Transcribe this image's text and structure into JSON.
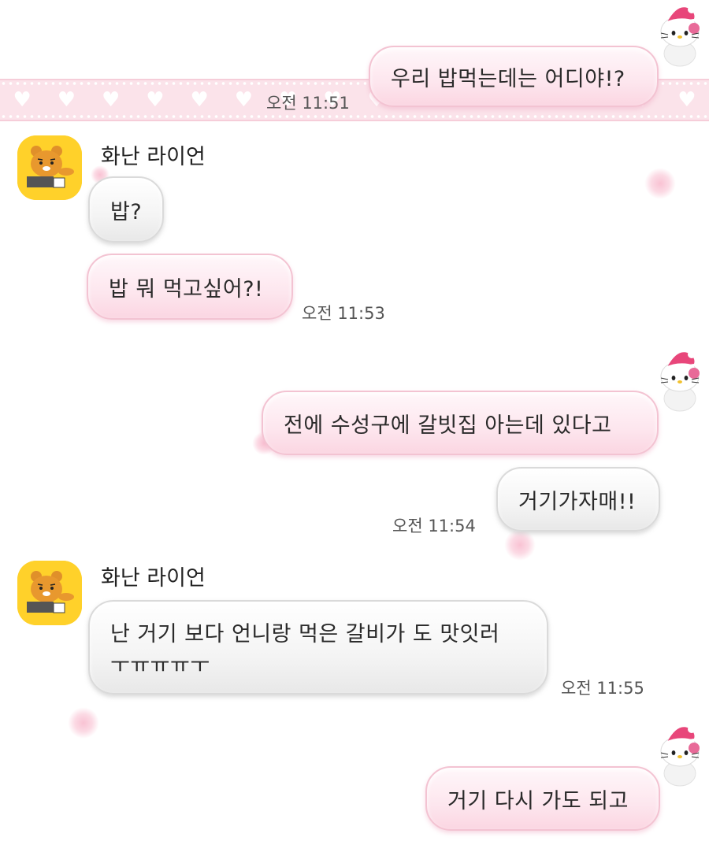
{
  "chat": {
    "messages": [
      {
        "sender": "me",
        "text": "우리 밥먹는데는 어디야!?",
        "time": "오전 11:51"
      },
      {
        "sender": "화난 라이언",
        "texts": [
          "밥?",
          "밥 뭐 먹고싶어?!"
        ],
        "time": "오전 11:53"
      },
      {
        "sender": "me",
        "texts": [
          "전에 수성구에 갈빗집 아는데 있다고",
          "거기가자매!!"
        ],
        "time": "오전 11:54"
      },
      {
        "sender": "화난 라이언",
        "text": "난 거기 보다 언니랑 먹은 갈비가 도 맛잇러 ㅜㅠㅠㅠㅜ",
        "time": "오전 11:55"
      },
      {
        "sender": "me",
        "text": "거기 다시 가도 되고"
      }
    ]
  },
  "avatars": {
    "friend": "ryan-avatar-icon",
    "me": "hello-kitty-avatar-icon"
  },
  "colors": {
    "my_bubble": "#fde6ee",
    "friend_bubble": "#f4f4f4",
    "lace": "#fbe3ea",
    "avatar_bg": "#ffd12a"
  }
}
